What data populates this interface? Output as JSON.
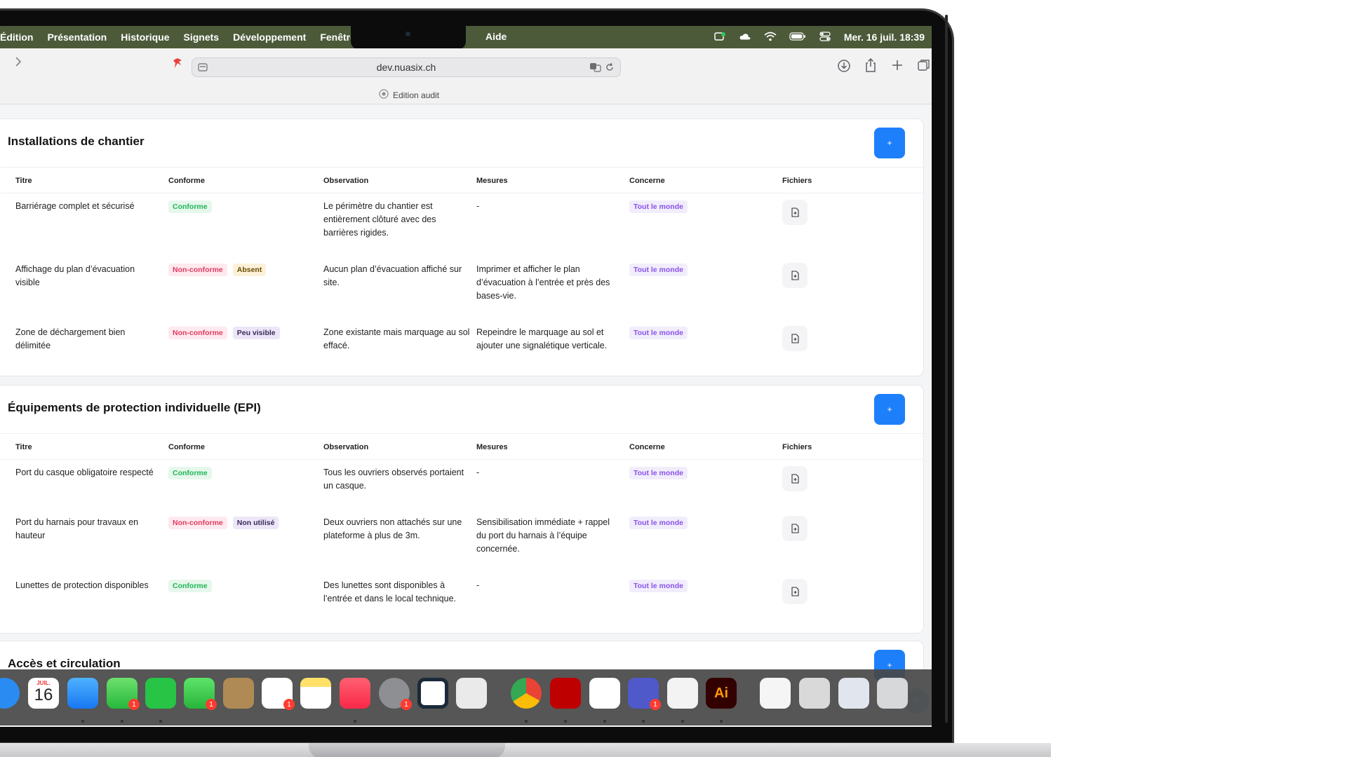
{
  "menubar": {
    "items": [
      "Édition",
      "Présentation",
      "Historique",
      "Signets",
      "Développement",
      "Fenêtre"
    ],
    "help": "Aide",
    "clock": "Mer. 16 juil.  18:39"
  },
  "browser": {
    "url": "dev.nuasix.ch",
    "tab_label": "Edition audit"
  },
  "table_headers": [
    "Titre",
    "Conforme",
    "Observation",
    "Mesures",
    "Concerne",
    "Fichiers"
  ],
  "sections": [
    {
      "title": "Installations de chantier",
      "add_label": "+",
      "rows": [
        {
          "title": "Barriérage complet et sécurisé",
          "status": "Conforme",
          "tag": "",
          "observation": "Le périmètre du chantier est entièrement clôturé avec des barrières rigides.",
          "measures": "-",
          "concerne": "Tout le monde"
        },
        {
          "title": "Affichage du plan d’évacuation visible",
          "status": "Non-conforme",
          "tag": "Absent",
          "observation": "Aucun plan d’évacuation affiché sur site.",
          "measures": "Imprimer et afficher le plan d’évacuation à l’entrée et près des bases-vie.",
          "concerne": "Tout le monde"
        },
        {
          "title": "Zone de déchargement bien délimitée",
          "status": "Non-conforme",
          "tag": "Peu visible",
          "observation": "Zone existante mais marquage au sol effacé.",
          "measures": "Repeindre le marquage au sol et ajouter une signalétique verticale.",
          "concerne": "Tout le monde"
        }
      ]
    },
    {
      "title": "Équipements de protection individuelle (EPI)",
      "add_label": "+",
      "rows": [
        {
          "title": "Port du casque obligatoire respecté",
          "status": "Conforme",
          "tag": "",
          "observation": "Tous les ouvriers observés portaient un casque.",
          "measures": "-",
          "concerne": "Tout le monde"
        },
        {
          "title": "Port du harnais pour travaux en hauteur",
          "status": "Non-conforme",
          "tag": "Non utilisé",
          "observation": "Deux ouvriers non attachés sur une plateforme à plus de 3m.",
          "measures": "Sensibilisation immédiate + rappel du port du harnais à l’équipe concernée.",
          "concerne": "Tout le monde"
        },
        {
          "title": "Lunettes de protection disponibles",
          "status": "Conforme",
          "tag": "",
          "observation": "Des lunettes sont disponibles à l’entrée et dans le local technique.",
          "measures": "-",
          "concerne": "Tout le monde"
        }
      ]
    },
    {
      "title": "Accès et circulation",
      "add_label": "+"
    }
  ],
  "dock": {
    "calendar_month": "JUIL.",
    "calendar_day": "16",
    "badges": [
      "1",
      "1",
      "1",
      "1",
      "1"
    ],
    "illustrator_label": "Ai"
  }
}
